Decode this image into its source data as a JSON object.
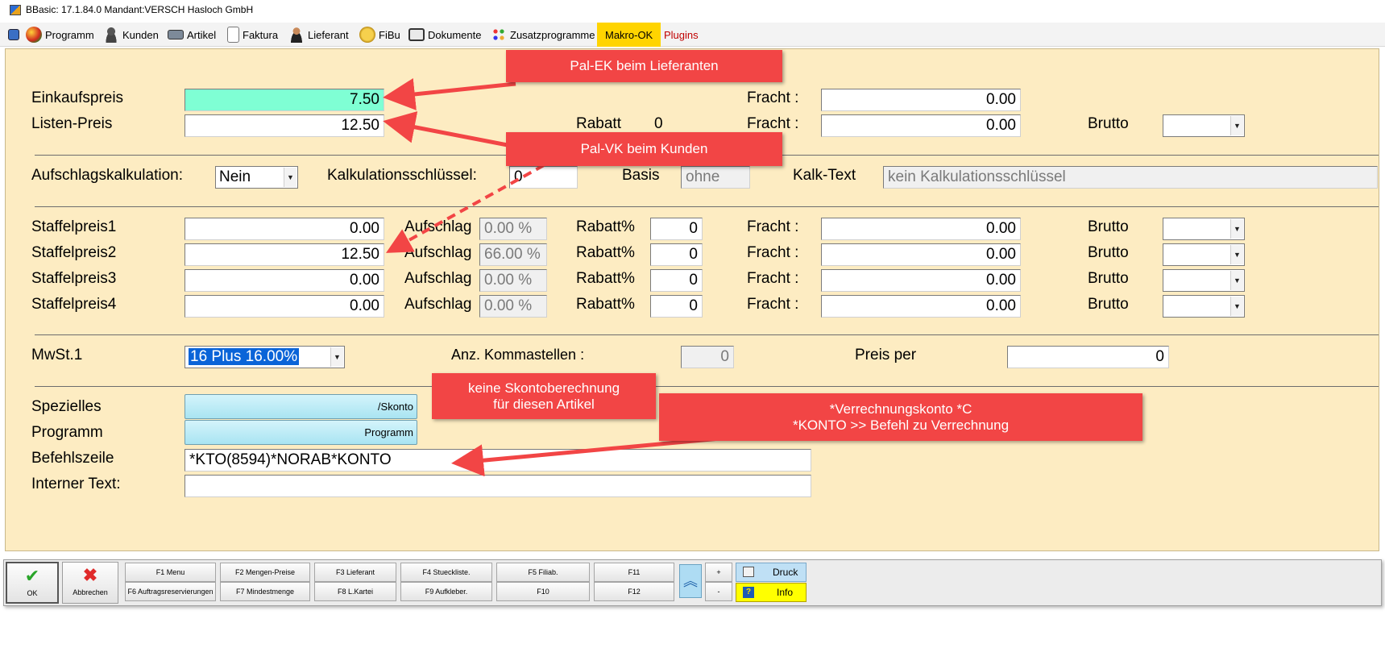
{
  "window": {
    "title": "BBasic: 17.1.84.0 Mandant:VERSCH Hasloch GmbH"
  },
  "menu": {
    "items": [
      {
        "label": "Programm",
        "icon": "globe-icon"
      },
      {
        "label": "Kunden",
        "icon": "users-icon"
      },
      {
        "label": "Artikel",
        "icon": "keyboard-icon"
      },
      {
        "label": "Faktura",
        "icon": "document-icon"
      },
      {
        "label": "Lieferant",
        "icon": "person-icon"
      },
      {
        "label": "FiBu",
        "icon": "coins-icon"
      },
      {
        "label": "Dokumente",
        "icon": "monitor-icon"
      },
      {
        "label": "Zusatzprogramme",
        "icon": "dots-icon"
      }
    ],
    "makro_label": "Makro-OK",
    "plugins_label": "Plugins"
  },
  "prices": {
    "einkaufspreis_label": "Einkaufspreis",
    "einkaufspreis_value": "7.50",
    "listenpreis_label": "Listen-Preis",
    "listenpreis_value": "12.50",
    "rabatt_label": "Rabatt",
    "rabatt_value": "0",
    "fracht_label": "Fracht :",
    "fracht1_value": "0.00",
    "fracht2_value": "0.00",
    "brutto_label": "Brutto",
    "brutto_value": ""
  },
  "kalkulation": {
    "aufschlag_label": "Aufschlagskalkulation:",
    "aufschlag_value": "Nein",
    "schluessel_label": "Kalkulationsschlüssel:",
    "schluessel_value": "0",
    "basis_label": "Basis",
    "basis_value": "ohne",
    "kalktext_label": "Kalk-Text",
    "kalktext_value": "kein Kalkulationsschlüssel"
  },
  "staffel": {
    "aufschlag_label": "Aufschlag",
    "rabatt_label": "Rabatt%",
    "fracht_label": "Fracht :",
    "brutto_label": "Brutto",
    "rows": [
      {
        "label": "Staffelpreis1",
        "preis": "0.00",
        "aufschlag": "0.00 %",
        "rabatt": "0",
        "fracht": "0.00",
        "brutto": ""
      },
      {
        "label": "Staffelpreis2",
        "preis": "12.50",
        "aufschlag": "66.00 %",
        "rabatt": "0",
        "fracht": "0.00",
        "brutto": ""
      },
      {
        "label": "Staffelpreis3",
        "preis": "0.00",
        "aufschlag": "0.00 %",
        "rabatt": "0",
        "fracht": "0.00",
        "brutto": ""
      },
      {
        "label": "Staffelpreis4",
        "preis": "0.00",
        "aufschlag": "0.00 %",
        "rabatt": "0",
        "fracht": "0.00",
        "brutto": ""
      }
    ]
  },
  "mwst": {
    "label": "MwSt.1",
    "value": "16 Plus 16.00%",
    "komma_label": "Anz. Kommastellen :",
    "komma_value": "0",
    "preisper_label": "Preis per",
    "preisper_value": "0"
  },
  "special": {
    "spezielles_label": "Spezielles",
    "spezielles_button": "/Skonto",
    "programm_label": "Programm",
    "programm_button": "Programm",
    "befehl_label": "Befehlszeile",
    "befehl_value": "*KTO(8594)*NORAB*KONTO",
    "intern_label": "Interner Text:",
    "intern_value": ""
  },
  "annotations": {
    "pal_ek": "Pal-EK beim Lieferanten",
    "pal_vk": "Pal-VK  beim Kunden",
    "skonto_line1": "keine Skontoberechnung",
    "skonto_line2": "für diesen Artikel",
    "konto_line1": "*Verrechnungskonto    *C",
    "konto_line2": "*KONTO  >> Befehl zu Verrechnung",
    "color": "#f24545"
  },
  "toolbar": {
    "ok_label": "OK",
    "abbrechen_label": "Abbrechen",
    "f1": "F1 Menu",
    "f2": "F2 Mengen-Preise",
    "f3": "F3 Lieferant",
    "f4": "F4 Stueckliste.",
    "f5": "F5 Filiab.",
    "f11": "F11",
    "f6": "F6 Auftragsreservierungen",
    "f7": "F7 Mindestmenge",
    "f8": "F8 L.Kartei",
    "f9": "F9 Aufkleber.",
    "f10": "F10",
    "f12": "F12",
    "plus": "+",
    "minus": "-",
    "druck_label": "Druck",
    "info_label": "Info"
  }
}
